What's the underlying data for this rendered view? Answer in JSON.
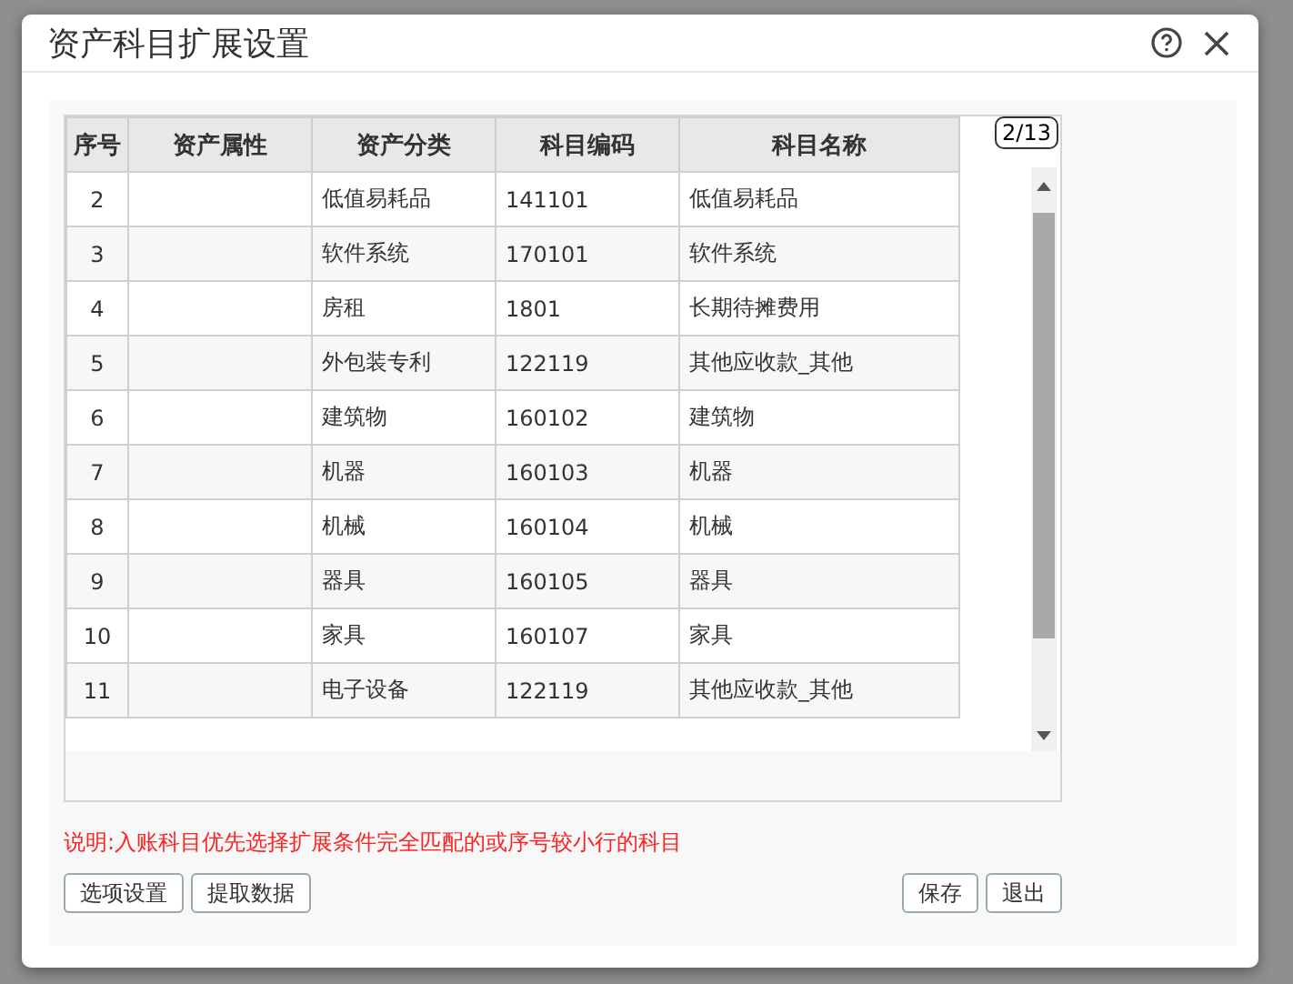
{
  "dialog": {
    "title": "资产科目扩展设置"
  },
  "table": {
    "columns": [
      "序号",
      "资产属性",
      "资产分类",
      "科目编码",
      "科目名称"
    ],
    "rows": [
      [
        "2",
        "",
        "低值易耗品",
        "141101",
        "低值易耗品"
      ],
      [
        "3",
        "",
        "软件系统",
        "170101",
        "软件系统"
      ],
      [
        "4",
        "",
        "房租",
        "1801",
        "长期待摊费用"
      ],
      [
        "5",
        "",
        "外包装专利",
        "122119",
        "其他应收款_其他"
      ],
      [
        "6",
        "",
        "建筑物",
        "160102",
        "建筑物"
      ],
      [
        "7",
        "",
        "机器",
        "160103",
        "机器"
      ],
      [
        "8",
        "",
        "机械",
        "160104",
        "机械"
      ],
      [
        "9",
        "",
        "器具",
        "160105",
        "器具"
      ],
      [
        "10",
        "",
        "家具",
        "160107",
        "家具"
      ],
      [
        "11",
        "",
        "电子设备",
        "122119",
        "其他应收款_其他"
      ]
    ],
    "page_badge": "2/13"
  },
  "note": "说明:入账科目优先选择扩展条件完全匹配的或序号较小行的科目",
  "left_buttons": [
    "选项设置",
    "提取数据"
  ],
  "right_buttons": [
    "保存",
    "退出"
  ]
}
